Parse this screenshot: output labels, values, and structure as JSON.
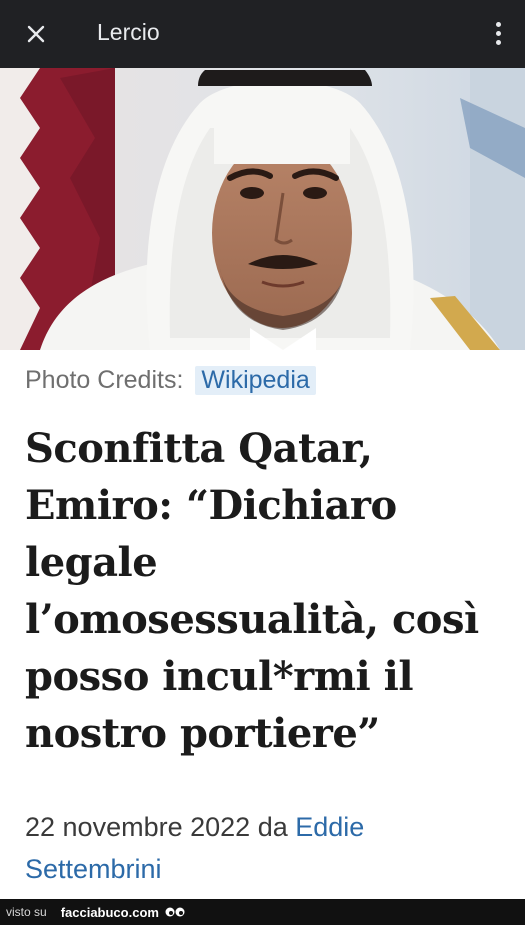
{
  "app_bar": {
    "title": "Lercio",
    "close_icon": "close-icon",
    "menu_icon": "more-vert-icon"
  },
  "article": {
    "photo_credits_label": "Photo Credits:",
    "photo_credits_source": "Wikipedia",
    "headline_lines": [
      "Sconfitta Qatar,",
      "Emiro: “Dichiaro",
      "legale",
      "l’omosessualità, così",
      "posso incul*rmi il",
      "nostro portiere”"
    ],
    "date": "22 novembre 2022",
    "by": "da",
    "author_first": "Eddie",
    "author_last": "Settembrini"
  },
  "footer": {
    "seen_on": "visto su",
    "brand": "facciabuco.com"
  },
  "colors": {
    "topbar": "#202124",
    "link": "#2c6aa8",
    "link_bg": "#e3eef8"
  }
}
